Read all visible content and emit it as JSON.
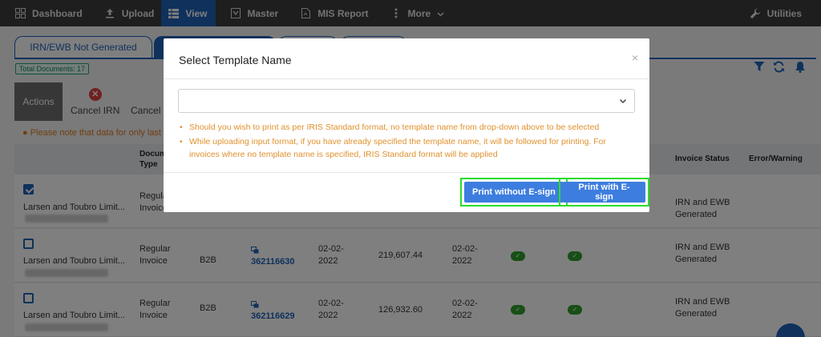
{
  "nav": {
    "items": [
      {
        "label": "Dashboard"
      },
      {
        "label": "Upload"
      },
      {
        "label": "View"
      },
      {
        "label": "Master"
      },
      {
        "label": "MIS Report"
      },
      {
        "label": "More"
      }
    ],
    "utilities": "Utilities"
  },
  "tabs": [
    "IRN/EWB Not Generated",
    "",
    "",
    ""
  ],
  "total_documents": "Total Documents: 17",
  "actions": {
    "label": "Actions",
    "cancel_irn": "Cancel IRN",
    "cancel_ewb": "Cancel E"
  },
  "note": "Please note that data for only last a",
  "table": {
    "headers": {
      "doc_type": "Document\nType",
      "invoice_status": "Invoice Status",
      "error_warning": "Error/Warning"
    },
    "rows": [
      {
        "party": "Larsen and Toubro Limit...",
        "doc_type": "Regular\nInvoice",
        "supply": "",
        "doc_no": "",
        "doc_date": "",
        "value": "",
        "ewb_date": "",
        "status": "IRN and EWB\nGenerated",
        "checked": true
      },
      {
        "party": "Larsen and Toubro Limit...",
        "doc_type": "Regular\nInvoice",
        "supply": "B2B",
        "doc_no": "362116630",
        "doc_date": "02-02-\n2022",
        "value": "219,607.44",
        "ewb_date": "02-02-\n2022",
        "status": "IRN and EWB\nGenerated",
        "checked": false
      },
      {
        "party": "Larsen and Toubro Limit...",
        "doc_type": "Regular\nInvoice",
        "supply": "B2B",
        "doc_no": "362116629",
        "doc_date": "02-02-\n2022",
        "value": "126,932.60",
        "ewb_date": "02-02-\n2022",
        "status": "IRN and EWB\nGenerated",
        "checked": false
      }
    ]
  },
  "modal": {
    "title": "Select Template Name",
    "close": "×",
    "select_value": "",
    "bullet_1": "Should you wish to print as per IRIS Standard format, no template name from drop-down above to be selected",
    "bullet_2": "While uploading input format, if you have already specified the template name, it will be followed for printing. For invoices where no template name is specified, IRIS Standard format will be applied",
    "btn_print_without": "Print without E-sign",
    "btn_print_with": "Print with E-sign"
  },
  "colors": {
    "nav_bg": "#3c3c3c",
    "accent": "#1f62b8",
    "button": "#3d7de0",
    "highlight": "#2bdc2b",
    "note": "#e0912d"
  }
}
